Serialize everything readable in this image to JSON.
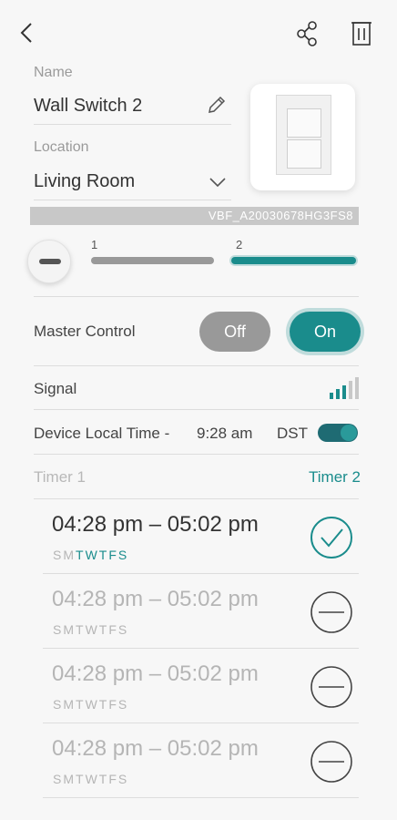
{
  "header": {
    "back_icon": "chevron-left-icon",
    "share_icon": "share-icon",
    "delete_icon": "trash-icon"
  },
  "name_field": {
    "label": "Name",
    "value": "Wall Switch 2",
    "edit_icon": "pencil-icon"
  },
  "location_field": {
    "label": "Location",
    "value": "Living Room",
    "dropdown_icon": "chevron-down-icon"
  },
  "device": {
    "serial": "VBF_A20030678HG3FS8",
    "image": "wall-switch-image"
  },
  "gangs": [
    {
      "label": "1",
      "selected": false
    },
    {
      "label": "2",
      "selected": true
    }
  ],
  "master_control": {
    "label": "Master Control",
    "off_label": "Off",
    "on_label": "On",
    "state": "On"
  },
  "signal": {
    "label": "Signal",
    "icon": "signal-bars-icon",
    "bars": 5,
    "active_bars": 3
  },
  "local_time": {
    "label": "Device Local Time -",
    "value": "9:28 am",
    "dst_label": "DST",
    "dst_on": true
  },
  "timer_tabs": {
    "tab1": "Timer 1",
    "tab2": "Timer 2",
    "active": "Timer 2"
  },
  "timers": [
    {
      "range": "04:28 pm – 05:02 pm",
      "days": [
        "S",
        "M",
        "T",
        "W",
        "T",
        "F",
        "S"
      ],
      "active_days": [
        2,
        3,
        4,
        5,
        6
      ],
      "enabled": true,
      "icon": "check-circle-icon"
    },
    {
      "range": "04:28 pm – 05:02 pm",
      "days": [
        "S",
        "M",
        "T",
        "W",
        "T",
        "F",
        "S"
      ],
      "active_days": [],
      "enabled": false,
      "icon": "minus-circle-icon"
    },
    {
      "range": "04:28 pm – 05:02 pm",
      "days": [
        "S",
        "M",
        "T",
        "W",
        "T",
        "F",
        "S"
      ],
      "active_days": [],
      "enabled": false,
      "icon": "minus-circle-icon"
    },
    {
      "range": "04:28 pm – 05:02 pm",
      "days": [
        "S",
        "M",
        "T",
        "W",
        "T",
        "F",
        "S"
      ],
      "active_days": [],
      "enabled": false,
      "icon": "minus-circle-icon"
    }
  ],
  "colors": {
    "accent": "#1a8c8c",
    "muted": "#b5b5b5",
    "off_pill": "#999999"
  }
}
